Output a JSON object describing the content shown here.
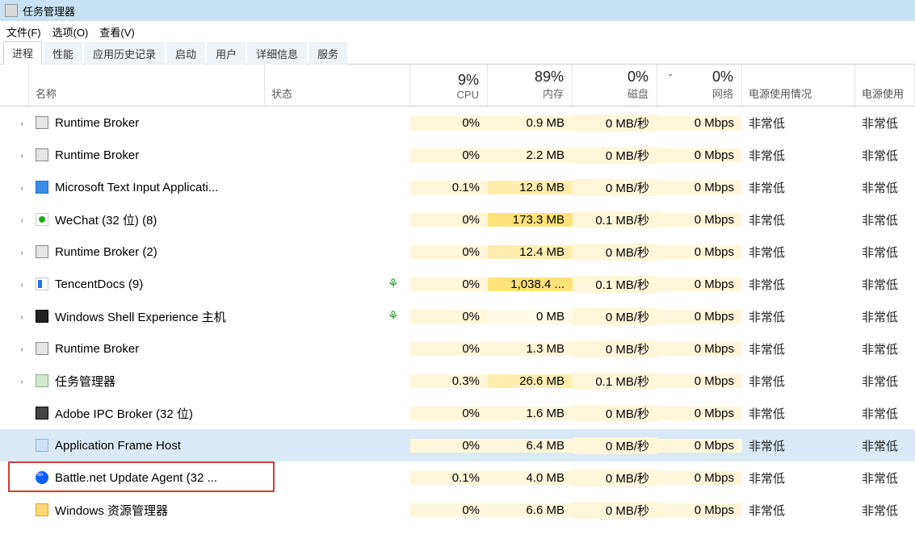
{
  "window": {
    "title": "任务管理器"
  },
  "menu": {
    "file": "文件(F)",
    "options": "选项(O)",
    "view": "查看(V)"
  },
  "tabs": {
    "items": [
      "进程",
      "性能",
      "应用历史记录",
      "启动",
      "用户",
      "详细信息",
      "服务"
    ],
    "active": 0
  },
  "columns": {
    "name": "名称",
    "state": "状态",
    "cpu_pct": "9%",
    "cpu": "CPU",
    "mem_pct": "89%",
    "mem": "内存",
    "disk_pct": "0%",
    "disk": "磁盘",
    "net_pct": "0%",
    "net": "网络",
    "power": "电源使用情况",
    "power_trend": "电源使用"
  },
  "rows": [
    {
      "expandable": true,
      "icon": "rb",
      "name": "Runtime Broker",
      "leaf": false,
      "cpu": "0%",
      "mem": "0.9 MB",
      "disk": "0 MB/秒",
      "net": "0 Mbps",
      "power": "非常低",
      "power2": "非常低"
    },
    {
      "expandable": true,
      "icon": "rb",
      "name": "Runtime Broker",
      "leaf": false,
      "cpu": "0%",
      "mem": "2.2 MB",
      "disk": "0 MB/秒",
      "net": "0 Mbps",
      "power": "非常低",
      "power2": "非常低"
    },
    {
      "expandable": true,
      "icon": "blue",
      "name": "Microsoft Text Input Applicati...",
      "leaf": false,
      "cpu": "0.1%",
      "mem": "12.6 MB",
      "disk": "0 MB/秒",
      "net": "0 Mbps",
      "power": "非常低",
      "power2": "非常低"
    },
    {
      "expandable": true,
      "icon": "green",
      "name": "WeChat (32 位) (8)",
      "leaf": false,
      "cpu": "0%",
      "mem": "173.3 MB",
      "disk": "0.1 MB/秒",
      "net": "0 Mbps",
      "power": "非常低",
      "power2": "非常低"
    },
    {
      "expandable": true,
      "icon": "rb",
      "name": "Runtime Broker (2)",
      "leaf": false,
      "cpu": "0%",
      "mem": "12.4 MB",
      "disk": "0 MB/秒",
      "net": "0 Mbps",
      "power": "非常低",
      "power2": "非常低"
    },
    {
      "expandable": true,
      "icon": "tdoc",
      "name": "TencentDocs (9)",
      "leaf": true,
      "cpu": "0%",
      "mem": "1,038.4 ...",
      "disk": "0.1 MB/秒",
      "net": "0 Mbps",
      "power": "非常低",
      "power2": "非常低"
    },
    {
      "expandable": true,
      "icon": "shell",
      "name": "Windows Shell Experience 主机",
      "leaf": true,
      "cpu": "0%",
      "mem": "0 MB",
      "disk": "0 MB/秒",
      "net": "0 Mbps",
      "power": "非常低",
      "power2": "非常低"
    },
    {
      "expandable": true,
      "icon": "rb",
      "name": "Runtime Broker",
      "leaf": false,
      "cpu": "0%",
      "mem": "1.3 MB",
      "disk": "0 MB/秒",
      "net": "0 Mbps",
      "power": "非常低",
      "power2": "非常低"
    },
    {
      "expandable": true,
      "icon": "tm",
      "name": "任务管理器",
      "leaf": false,
      "cpu": "0.3%",
      "mem": "26.6 MB",
      "disk": "0.1 MB/秒",
      "net": "0 Mbps",
      "power": "非常低",
      "power2": "非常低"
    },
    {
      "expandable": false,
      "icon": "adobe",
      "name": "Adobe IPC Broker (32 位)",
      "leaf": false,
      "cpu": "0%",
      "mem": "1.6 MB",
      "disk": "0 MB/秒",
      "net": "0 Mbps",
      "power": "非常低",
      "power2": "非常低"
    },
    {
      "expandable": false,
      "icon": "afh",
      "name": "Application Frame Host",
      "leaf": false,
      "cpu": "0%",
      "mem": "6.4 MB",
      "disk": "0 MB/秒",
      "net": "0 Mbps",
      "power": "非常低",
      "power2": "非常低",
      "hovered": true
    },
    {
      "expandable": false,
      "icon": "bnet",
      "name": "Battle.net Update Agent (32 ...",
      "leaf": false,
      "cpu": "0.1%",
      "mem": "4.0 MB",
      "disk": "0 MB/秒",
      "net": "0 Mbps",
      "power": "非常低",
      "power2": "非常低",
      "boxed": true
    },
    {
      "expandable": false,
      "icon": "explorer",
      "name": "Windows 资源管理器",
      "leaf": false,
      "cpu": "0%",
      "mem": "6.6 MB",
      "disk": "0 MB/秒",
      "net": "0 Mbps",
      "power": "非常低",
      "power2": "非常低"
    }
  ]
}
